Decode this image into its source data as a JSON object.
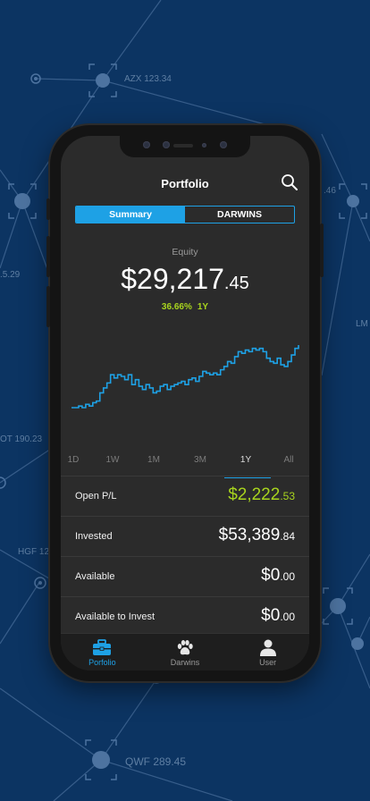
{
  "background": {
    "labels": [
      "AZX 123.34",
      ".46",
      ".5.29",
      "LM",
      "OT 190.23",
      "HGF 12",
      "QWF 289.45"
    ]
  },
  "header": {
    "title": "Portfolio"
  },
  "tabs": {
    "summary": "Summary",
    "darwins": "DARWINS",
    "active": "Summary"
  },
  "equity": {
    "label": "Equity",
    "value_main": "$29,217",
    "value_cents": ".45",
    "change_percent": "36.66%",
    "change_period": "1Y"
  },
  "chart_data": {
    "type": "line",
    "color": "#1ea1e5",
    "x_index": [
      0,
      4,
      8,
      12,
      16,
      20,
      24,
      28,
      32,
      36,
      40,
      44,
      48,
      52,
      56,
      60,
      64,
      68,
      72,
      76,
      80,
      84,
      88,
      92,
      96,
      100,
      104,
      108,
      112,
      116,
      120,
      124,
      128,
      132,
      136,
      140,
      144,
      148,
      152,
      156,
      160,
      164,
      168,
      172,
      176,
      180,
      184,
      188,
      192,
      196,
      200,
      204,
      208,
      212,
      216,
      220,
      224,
      228,
      232,
      236,
      240,
      244,
      248,
      252,
      256
    ],
    "values": [
      10,
      10,
      11,
      10,
      12,
      11,
      13,
      14,
      19,
      22,
      25,
      30,
      28,
      30,
      29,
      27,
      30,
      24,
      27,
      23,
      21,
      24,
      22,
      19,
      20,
      23,
      24,
      21,
      23,
      24,
      25,
      26,
      24,
      27,
      28,
      26,
      29,
      32,
      31,
      30,
      31,
      30,
      33,
      35,
      38,
      37,
      41,
      44,
      43,
      45,
      44,
      46,
      45,
      46,
      44,
      40,
      38,
      37,
      40,
      36,
      35,
      38,
      42,
      46,
      48
    ],
    "ranges": [
      "1D",
      "1W",
      "1M",
      "3M",
      "1Y",
      "All"
    ],
    "active_range": "1Y"
  },
  "rows": [
    {
      "label": "Open P/L",
      "main": "$2,222",
      "cents": ".53",
      "color": "#a8d41e"
    },
    {
      "label": "Invested",
      "main": "$53,389",
      "cents": ".84",
      "color": "#ffffff"
    },
    {
      "label": "Available",
      "main": "$0",
      "cents": ".00",
      "color": "#ffffff"
    },
    {
      "label": "Available to Invest",
      "main": "$0",
      "cents": ".00",
      "color": "#ffffff"
    }
  ],
  "tabbar": {
    "items": [
      {
        "label": "Porfolio",
        "icon": "briefcase-icon",
        "active": true
      },
      {
        "label": "Darwins",
        "icon": "paw-icon",
        "active": false
      },
      {
        "label": "User",
        "icon": "user-icon",
        "active": false
      }
    ]
  },
  "colors": {
    "accent": "#1ea1e5",
    "positive": "#a8d41e",
    "background": "#0c3462"
  }
}
